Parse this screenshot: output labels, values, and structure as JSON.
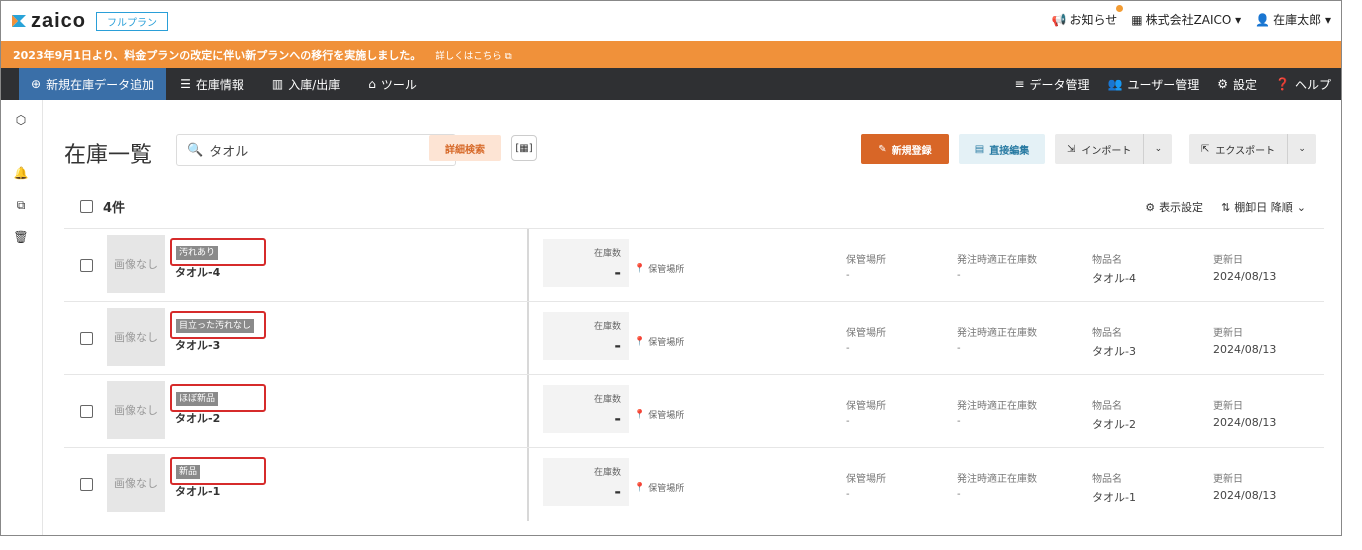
{
  "header": {
    "logo_text": "zaico",
    "plan_badge": "フルプラン",
    "notifications": "お知らせ",
    "company": "株式会社ZAICO ▾",
    "user": "在庫太郎 ▾"
  },
  "banner": {
    "message": "2023年9月1日より、料金プランの改定に伴い新プランへの移行を実施しました。",
    "link": "詳しくはこちら"
  },
  "nav": {
    "items": [
      "新規在庫データ追加",
      "在庫情報",
      "入庫/出庫",
      "ツール"
    ],
    "right": [
      "データ管理",
      "ユーザー管理",
      "設定",
      "ヘルプ"
    ]
  },
  "page": {
    "title": "在庫一覧",
    "search_value": "タオル",
    "search_clear": "✕",
    "detail_search": "詳細検索",
    "new_button": "新規登録",
    "edit_button": "直接編集",
    "import_button": "インポート",
    "export_button": "エクスポート",
    "count": "4件",
    "view_settings": "表示設定",
    "sort": "棚卸日 降順"
  },
  "column_labels": {
    "stock": "在庫数",
    "location_link": "保管場所",
    "location": "保管場所",
    "order_stock": "発注時適正在庫数",
    "name": "物品名",
    "updated": "更新日",
    "no_image": "画像なし"
  },
  "rows": [
    {
      "tag": "汚れあり",
      "name": "タオル-4",
      "stock": "-",
      "location": "-",
      "order_stock": "-",
      "item": "タオル-4",
      "updated": "2024/08/13"
    },
    {
      "tag": "目立った汚れなし",
      "name": "タオル-3",
      "stock": "-",
      "location": "-",
      "order_stock": "-",
      "item": "タオル-3",
      "updated": "2024/08/13"
    },
    {
      "tag": "ほぼ新品",
      "name": "タオル-2",
      "stock": "-",
      "location": "-",
      "order_stock": "-",
      "item": "タオル-2",
      "updated": "2024/08/13"
    },
    {
      "tag": "新品",
      "name": "タオル-1",
      "stock": "-",
      "location": "-",
      "order_stock": "-",
      "item": "タオル-1",
      "updated": "2024/08/13"
    }
  ]
}
